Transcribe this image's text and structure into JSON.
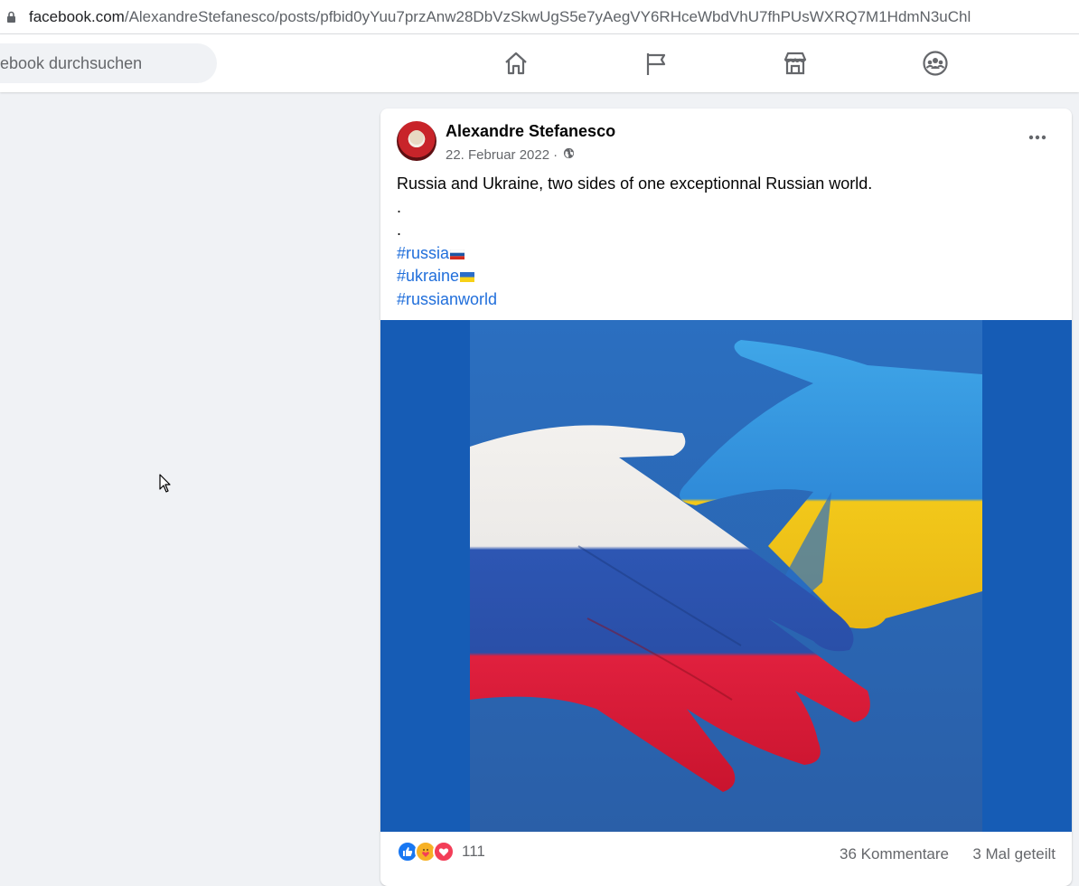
{
  "browser": {
    "url_host": "facebook.com",
    "url_path": "/AlexandreStefanesco/posts/pfbid0yYuu7przAnw28DbVzSkwUgS5e7yAegVY6RHceWbdVhU7fhPUsWXRQ7M1HdmN3uChl"
  },
  "topnav": {
    "search_placeholder": "ebook durchsuchen",
    "icons": [
      "home-icon",
      "pages-flag-icon",
      "marketplace-icon",
      "groups-icon"
    ]
  },
  "post": {
    "author": "Alexandre Stefanesco",
    "date": "22. Februar 2022",
    "separator": "·",
    "text_line1": "Russia and Ukraine, two sides of one exceptionnal Russian world.",
    "text_line2": ".",
    "text_line3": ".",
    "hashtag1": "#russia",
    "hashtag2": "#ukraine",
    "hashtag3": "#russianworld",
    "reactions_count": "111",
    "comments": "36 Kommentare",
    "shares": "3 Mal geteilt"
  },
  "colors": {
    "link": "#216fdb",
    "background": "#f0f2f5",
    "secondary_text": "#65676b",
    "media_background": "#165cb5"
  }
}
